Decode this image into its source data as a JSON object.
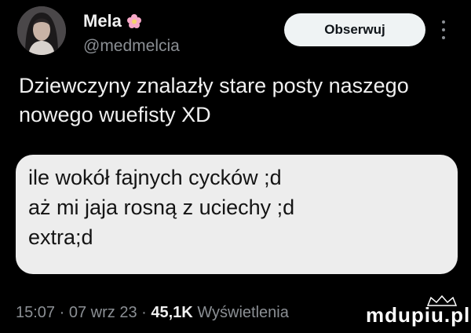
{
  "profile": {
    "display_name": "Mela",
    "name_emoji_icon": "flower-icon",
    "handle": "@medmelcia"
  },
  "header": {
    "follow_label": "Obserwuj",
    "more_icon": "more-vertical-icon"
  },
  "tweet": {
    "lines": [
      "Dziewczyny znalazły stare posty naszego",
      "nowego wuefisty XD"
    ]
  },
  "quote": {
    "lines": [
      "ile wokół fajnych cycków ;d",
      "aż mi jaja rosną z uciechy ;d",
      "extra;d"
    ]
  },
  "meta": {
    "time": "15:07",
    "separator": "·",
    "date": "07 wrz 23",
    "views_count": "45,1K",
    "views_label": "Wyświetlenia"
  },
  "watermark": {
    "text": "mdupiu.pl"
  },
  "colors": {
    "background": "#000000",
    "text_primary": "#e7e9ea",
    "text_secondary": "#8b8f94",
    "follow_button_bg": "#eff3f4",
    "quote_card_bg": "#ededed"
  }
}
